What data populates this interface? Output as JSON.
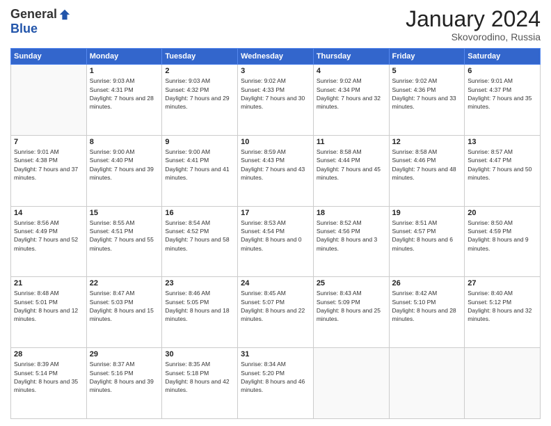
{
  "logo": {
    "general": "General",
    "blue": "Blue"
  },
  "header": {
    "month": "January 2024",
    "location": "Skovorodino, Russia"
  },
  "weekdays": [
    "Sunday",
    "Monday",
    "Tuesday",
    "Wednesday",
    "Thursday",
    "Friday",
    "Saturday"
  ],
  "weeks": [
    [
      {
        "day": null
      },
      {
        "day": 1,
        "sunrise": "9:03 AM",
        "sunset": "4:31 PM",
        "daylight": "7 hours and 28 minutes."
      },
      {
        "day": 2,
        "sunrise": "9:03 AM",
        "sunset": "4:32 PM",
        "daylight": "7 hours and 29 minutes."
      },
      {
        "day": 3,
        "sunrise": "9:02 AM",
        "sunset": "4:33 PM",
        "daylight": "7 hours and 30 minutes."
      },
      {
        "day": 4,
        "sunrise": "9:02 AM",
        "sunset": "4:34 PM",
        "daylight": "7 hours and 32 minutes."
      },
      {
        "day": 5,
        "sunrise": "9:02 AM",
        "sunset": "4:36 PM",
        "daylight": "7 hours and 33 minutes."
      },
      {
        "day": 6,
        "sunrise": "9:01 AM",
        "sunset": "4:37 PM",
        "daylight": "7 hours and 35 minutes."
      }
    ],
    [
      {
        "day": 7,
        "sunrise": "9:01 AM",
        "sunset": "4:38 PM",
        "daylight": "7 hours and 37 minutes."
      },
      {
        "day": 8,
        "sunrise": "9:00 AM",
        "sunset": "4:40 PM",
        "daylight": "7 hours and 39 minutes."
      },
      {
        "day": 9,
        "sunrise": "9:00 AM",
        "sunset": "4:41 PM",
        "daylight": "7 hours and 41 minutes."
      },
      {
        "day": 10,
        "sunrise": "8:59 AM",
        "sunset": "4:43 PM",
        "daylight": "7 hours and 43 minutes."
      },
      {
        "day": 11,
        "sunrise": "8:58 AM",
        "sunset": "4:44 PM",
        "daylight": "7 hours and 45 minutes."
      },
      {
        "day": 12,
        "sunrise": "8:58 AM",
        "sunset": "4:46 PM",
        "daylight": "7 hours and 48 minutes."
      },
      {
        "day": 13,
        "sunrise": "8:57 AM",
        "sunset": "4:47 PM",
        "daylight": "7 hours and 50 minutes."
      }
    ],
    [
      {
        "day": 14,
        "sunrise": "8:56 AM",
        "sunset": "4:49 PM",
        "daylight": "7 hours and 52 minutes."
      },
      {
        "day": 15,
        "sunrise": "8:55 AM",
        "sunset": "4:51 PM",
        "daylight": "7 hours and 55 minutes."
      },
      {
        "day": 16,
        "sunrise": "8:54 AM",
        "sunset": "4:52 PM",
        "daylight": "7 hours and 58 minutes."
      },
      {
        "day": 17,
        "sunrise": "8:53 AM",
        "sunset": "4:54 PM",
        "daylight": "8 hours and 0 minutes."
      },
      {
        "day": 18,
        "sunrise": "8:52 AM",
        "sunset": "4:56 PM",
        "daylight": "8 hours and 3 minutes."
      },
      {
        "day": 19,
        "sunrise": "8:51 AM",
        "sunset": "4:57 PM",
        "daylight": "8 hours and 6 minutes."
      },
      {
        "day": 20,
        "sunrise": "8:50 AM",
        "sunset": "4:59 PM",
        "daylight": "8 hours and 9 minutes."
      }
    ],
    [
      {
        "day": 21,
        "sunrise": "8:48 AM",
        "sunset": "5:01 PM",
        "daylight": "8 hours and 12 minutes."
      },
      {
        "day": 22,
        "sunrise": "8:47 AM",
        "sunset": "5:03 PM",
        "daylight": "8 hours and 15 minutes."
      },
      {
        "day": 23,
        "sunrise": "8:46 AM",
        "sunset": "5:05 PM",
        "daylight": "8 hours and 18 minutes."
      },
      {
        "day": 24,
        "sunrise": "8:45 AM",
        "sunset": "5:07 PM",
        "daylight": "8 hours and 22 minutes."
      },
      {
        "day": 25,
        "sunrise": "8:43 AM",
        "sunset": "5:09 PM",
        "daylight": "8 hours and 25 minutes."
      },
      {
        "day": 26,
        "sunrise": "8:42 AM",
        "sunset": "5:10 PM",
        "daylight": "8 hours and 28 minutes."
      },
      {
        "day": 27,
        "sunrise": "8:40 AM",
        "sunset": "5:12 PM",
        "daylight": "8 hours and 32 minutes."
      }
    ],
    [
      {
        "day": 28,
        "sunrise": "8:39 AM",
        "sunset": "5:14 PM",
        "daylight": "8 hours and 35 minutes."
      },
      {
        "day": 29,
        "sunrise": "8:37 AM",
        "sunset": "5:16 PM",
        "daylight": "8 hours and 39 minutes."
      },
      {
        "day": 30,
        "sunrise": "8:35 AM",
        "sunset": "5:18 PM",
        "daylight": "8 hours and 42 minutes."
      },
      {
        "day": 31,
        "sunrise": "8:34 AM",
        "sunset": "5:20 PM",
        "daylight": "8 hours and 46 minutes."
      },
      {
        "day": null
      },
      {
        "day": null
      },
      {
        "day": null
      }
    ]
  ]
}
